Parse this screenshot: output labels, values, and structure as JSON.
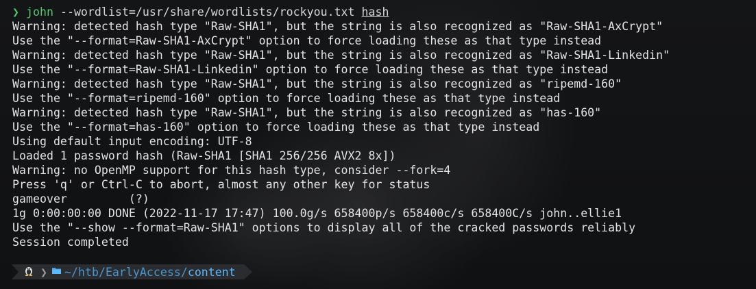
{
  "prompt": {
    "arrow": "❯",
    "command": "john",
    "args": " --wordlist=/usr/share/wordlists/rockyou.txt ",
    "hash_arg": "hash"
  },
  "output_lines": [
    "Warning: detected hash type \"Raw-SHA1\", but the string is also recognized as \"Raw-SHA1-AxCrypt\"",
    "Use the \"--format=Raw-SHA1-AxCrypt\" option to force loading these as that type instead",
    "Warning: detected hash type \"Raw-SHA1\", but the string is also recognized as \"Raw-SHA1-Linkedin\"",
    "Use the \"--format=Raw-SHA1-Linkedin\" option to force loading these as that type instead",
    "Warning: detected hash type \"Raw-SHA1\", but the string is also recognized as \"ripemd-160\"",
    "Use the \"--format=ripemd-160\" option to force loading these as that type instead",
    "Warning: detected hash type \"Raw-SHA1\", but the string is also recognized as \"has-160\"",
    "Use the \"--format=has-160\" option to force loading these as that type instead",
    "Using default input encoding: UTF-8",
    "Loaded 1 password hash (Raw-SHA1 [SHA1 256/256 AVX2 8x])",
    "Warning: no OpenMP support for this hash type, consider --fork=4",
    "Press 'q' or Ctrl-C to abort, almost any other key for status",
    "gameover         (?)",
    "1g 0:00:00:00 DONE (2022-11-17 17:47) 100.0g/s 658400p/s 658400c/s 658400C/s john..ellie1",
    "Use the \"--show --format=Raw-SHA1\" options to display all of the cracked passwords reliably",
    "Session completed"
  ],
  "promptbar": {
    "os_icon": "linux-tux-icon",
    "separator": "❯",
    "folder_icon": "folder-icon",
    "path_prefix": "~/htb/EarlyAccess/",
    "path_current": "content"
  }
}
